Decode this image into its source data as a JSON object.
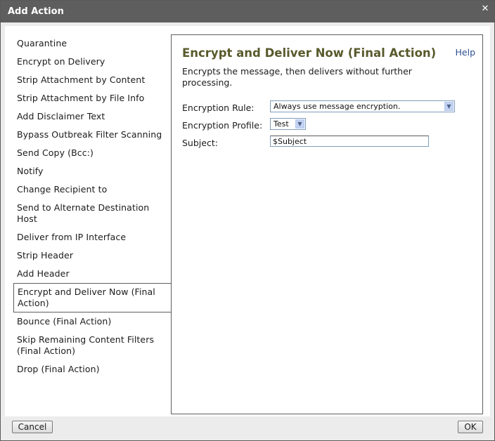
{
  "window": {
    "title": "Add Action"
  },
  "actions": [
    "Quarantine",
    "Encrypt on Delivery",
    "Strip Attachment by Content",
    "Strip Attachment by File Info",
    "Add Disclaimer Text",
    "Bypass Outbreak Filter Scanning",
    "Send Copy (Bcc:)",
    "Notify",
    "Change Recipient to",
    "Send to Alternate Destination Host",
    "Deliver from IP Interface",
    "Strip Header",
    "Add Header",
    "Encrypt and Deliver Now (Final Action)",
    "Bounce (Final Action)",
    "Skip Remaining Content Filters (Final Action)",
    "Drop (Final Action)"
  ],
  "selected_action": "Encrypt and Deliver Now (Final Action)",
  "panel": {
    "title": "Encrypt and Deliver Now (Final Action)",
    "help": "Help",
    "description": "Encrypts the message, then delivers without further processing.",
    "rule_label": "Encryption Rule:",
    "rule_value": "Always use message encryption.",
    "profile_label": "Encryption Profile:",
    "profile_value": "Test",
    "subject_label": "Subject:",
    "subject_value": "$Subject"
  },
  "buttons": {
    "cancel": "Cancel",
    "ok": "OK"
  },
  "icons": {
    "close": "close-icon",
    "dropdown": "chevron-down-icon"
  },
  "colors": {
    "titlebar": "#5e5e5e",
    "panel_title": "#595a2c",
    "link": "#2e4f92"
  }
}
